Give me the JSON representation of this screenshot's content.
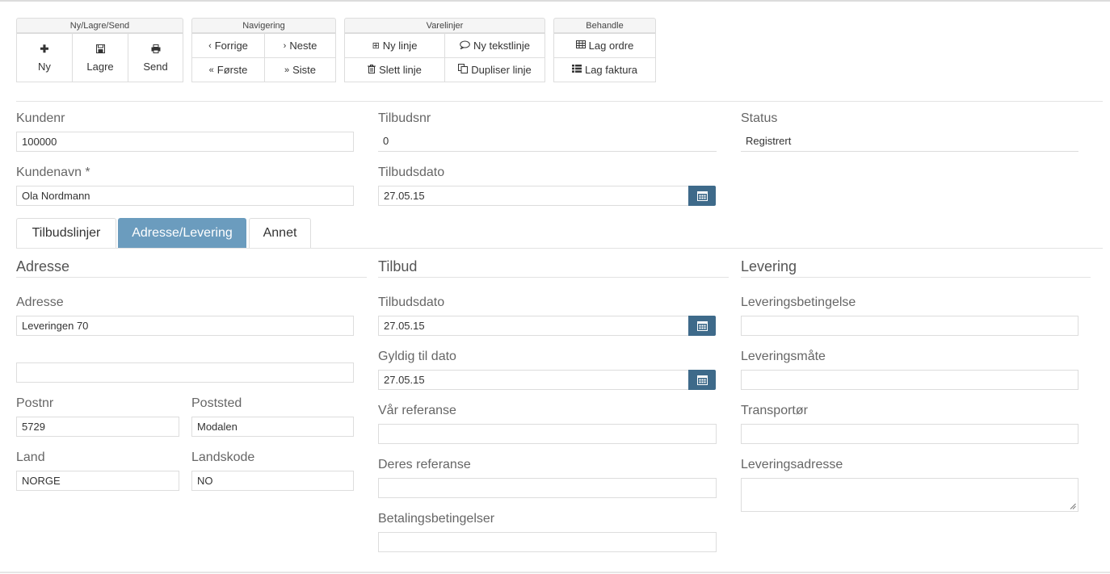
{
  "toolbar": {
    "group1": {
      "title": "Ny/Lagre/Send",
      "ny": "Ny",
      "lagre": "Lagre",
      "send": "Send"
    },
    "group2": {
      "title": "Navigering",
      "forrige": "Forrige",
      "neste": "Neste",
      "forste": "Første",
      "siste": "Siste"
    },
    "group3": {
      "title": "Varelinjer",
      "ny_linje": "Ny linje",
      "ny_tekstlinje": "Ny tekstlinje",
      "slett_linje": "Slett linje",
      "dupliser_linje": "Dupliser linje"
    },
    "group4": {
      "title": "Behandle",
      "lag_ordre": "Lag ordre",
      "lag_faktura": "Lag faktura"
    },
    "icons": {
      "ny": "plus-icon",
      "lagre": "save-icon",
      "send": "print-icon",
      "forrige": "chevron-left-icon",
      "neste": "chevron-right-icon",
      "forste": "double-chevron-left-icon",
      "siste": "double-chevron-right-icon",
      "ny_linje": "plus-square-icon",
      "ny_tekstlinje": "comment-icon",
      "slett_linje": "trash-icon",
      "dupliser_linje": "copy-icon",
      "lag_ordre": "table-icon",
      "lag_faktura": "list-icon"
    }
  },
  "header": {
    "kundenr_label": "Kundenr",
    "kundenr_value": "100000",
    "tilbudsnr_label": "Tilbudsnr",
    "tilbudsnr_value": "0",
    "status_label": "Status",
    "status_value": "Registrert",
    "kundenavn_label": "Kundenavn *",
    "kundenavn_value": "Ola Nordmann",
    "tilbudsdato_label": "Tilbudsdato",
    "tilbudsdato_value": "27.05.15"
  },
  "tabs": [
    {
      "label": "Tilbudslinjer"
    },
    {
      "label": "Adresse/Levering",
      "active": true
    },
    {
      "label": "Annet"
    }
  ],
  "adresse": {
    "title": "Adresse",
    "adresse_label": "Adresse",
    "adresse1": "Leveringen 70",
    "adresse2": "",
    "postnr_label": "Postnr",
    "postnr": "5729",
    "poststed_label": "Poststed",
    "poststed": "Modalen",
    "land_label": "Land",
    "land": "NORGE",
    "landskode_label": "Landskode",
    "landskode": "NO"
  },
  "tilbud": {
    "title": "Tilbud",
    "tilbudsdato_label": "Tilbudsdato",
    "tilbudsdato": "27.05.15",
    "gyldig_label": "Gyldig til dato",
    "gyldig": "27.05.15",
    "var_ref_label": "Vår referanse",
    "var_ref": "",
    "deres_ref_label": "Deres referanse",
    "deres_ref": "",
    "betaling_label": "Betalingsbetingelser",
    "betaling": ""
  },
  "levering": {
    "title": "Levering",
    "betingelse_label": "Leveringsbetingelse",
    "betingelse": "",
    "mate_label": "Leveringsmåte",
    "mate": "",
    "transportor_label": "Transportør",
    "transportor": "",
    "adresse_label": "Leveringsadresse",
    "adresse": ""
  },
  "colors": {
    "accent": "#6b9cbe",
    "calendar_button": "#3e6a8a"
  }
}
